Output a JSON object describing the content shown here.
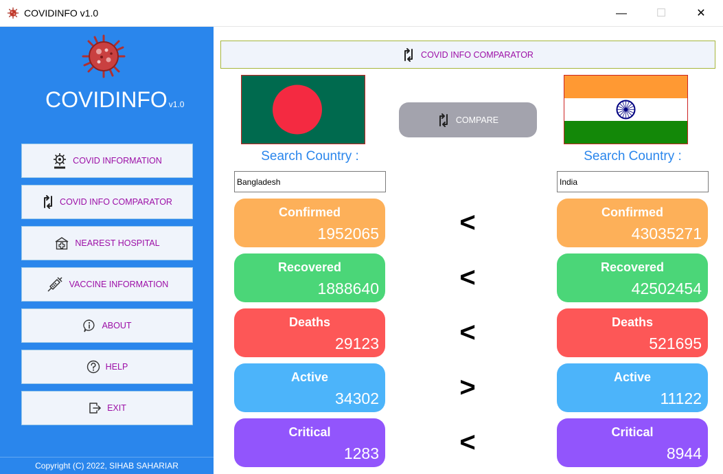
{
  "window": {
    "title": "COVIDINFO v1.0",
    "minimize_glyph": "—",
    "maximize_glyph": "☐",
    "close_glyph": "✕"
  },
  "sidebar": {
    "brand": "COVIDINFO",
    "brand_version": "v1.0",
    "nav": [
      {
        "label": "COVID INFORMATION",
        "icon": "covid19-gear-icon"
      },
      {
        "label": "COVID INFO COMPARATOR",
        "icon": "swap-arrows-icon"
      },
      {
        "label": "NEAREST HOSPITAL",
        "icon": "hospital-icon"
      },
      {
        "label": "VACCINE INFORMATION",
        "icon": "syringe-icon"
      },
      {
        "label": "ABOUT",
        "icon": "info-icon"
      },
      {
        "label": "HELP",
        "icon": "help-icon"
      },
      {
        "label": "EXIT",
        "icon": "exit-icon"
      }
    ],
    "copyright": "Copyright (C) 2022, SIHAB SAHARIAR"
  },
  "main": {
    "banner_title": "COVID INFO COMPARATOR",
    "compare_label": "COMPARE",
    "left": {
      "search_label": "Search Country :",
      "country": "Bangladesh",
      "flag": "bangladesh-flag"
    },
    "right": {
      "search_label": "Search Country :",
      "country": "India",
      "flag": "india-flag"
    },
    "stats": [
      {
        "label": "Confirmed",
        "left": "1952065",
        "right": "43035271",
        "sign": "<",
        "color": "#fdb059"
      },
      {
        "label": "Recovered",
        "left": "1888640",
        "right": "42502454",
        "sign": "<",
        "color": "#4bd678"
      },
      {
        "label": "Deaths",
        "left": "29123",
        "right": "521695",
        "sign": "<",
        "color": "#fd5757"
      },
      {
        "label": "Active",
        "left": "34302",
        "right": "11122",
        "sign": ">",
        "color": "#4cb4fa"
      },
      {
        "label": "Critical",
        "left": "1283",
        "right": "8944",
        "sign": "<",
        "color": "#9255fc"
      }
    ]
  }
}
